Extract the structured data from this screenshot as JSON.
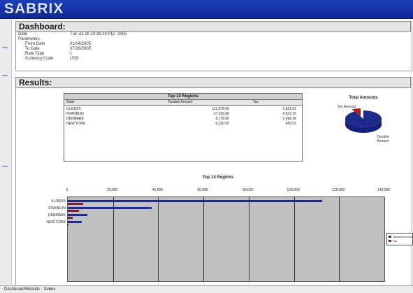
{
  "brand": {
    "name": "SABRIX"
  },
  "dashboard": {
    "title": "Dashboard:",
    "rows": [
      {
        "label": "Date",
        "value": "Tue Jul 26 10:36:29 PDT 2005"
      },
      {
        "label": "Parameters",
        "value": ""
      },
      {
        "label": "From Date",
        "value": "01/04/2005"
      },
      {
        "label": "To Date",
        "value": "07/26/2005"
      },
      {
        "label": "Rate Type",
        "value": "1"
      },
      {
        "label": "Currency Code",
        "value": "USD"
      }
    ]
  },
  "results": {
    "title": "Results:",
    "table": {
      "title": "Top 10 Regions",
      "columns": [
        "State",
        "Taxable Amount",
        "Tax"
      ],
      "rows": [
        {
          "state": "ILLINOIS",
          "taxable": "112,378.00",
          "tax": "6,851.62"
        },
        {
          "state": "FRANKLIN",
          "taxable": "37,026.00",
          "tax": "4,812.70"
        },
        {
          "state": "DENMARK",
          "taxable": "8,778.00",
          "tax": "2,098.38"
        },
        {
          "state": "NEW YORK",
          "taxable": "6,330.00",
          "tax": "443.03"
        }
      ]
    },
    "pie": {
      "title": "Total Amounts",
      "labels": [
        "Tax Amount",
        "Taxable Amount"
      ],
      "colors": [
        "#b3201f",
        "#1e2a8c"
      ],
      "tax_fraction": 0.08
    },
    "bar_chart": {
      "title": "Top 10 Regions",
      "legend": [
        "Taxable Amount",
        "Tax"
      ]
    },
    "status_bar": {
      "text": "Dashboard/Results · Sabrix"
    }
  },
  "chart_data": {
    "type": "bar",
    "orientation": "horizontal",
    "title": "Top 10 Regions",
    "categories": [
      "ILLINOIS",
      "FRANKLIN",
      "DENMARK",
      "NEW YORK"
    ],
    "series": [
      {
        "name": "Taxable Amount",
        "color": "#1e2a8c",
        "values": [
          112378,
          37026,
          8778,
          6330
        ]
      },
      {
        "name": "Tax",
        "color": "#7a1e3a",
        "values": [
          6851.62,
          4812.7,
          2098.38,
          443.03
        ]
      }
    ],
    "x_ticks": [
      "0",
      "20,000",
      "40,000",
      "60,000",
      "80,000",
      "100,000",
      "120,000",
      "140,000"
    ],
    "xlim": [
      0,
      140000
    ],
    "grid": true,
    "legend_position": "right"
  }
}
